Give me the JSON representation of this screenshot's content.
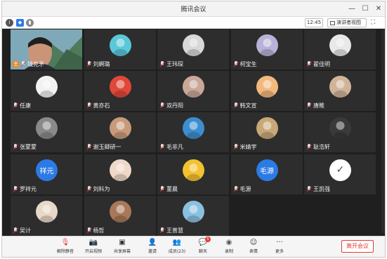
{
  "window": {
    "title": "腾讯会议"
  },
  "subbar": {
    "time": "12:45",
    "view_label": "演讲者视图"
  },
  "participants": [
    {
      "name": "钱克矛",
      "type": "video",
      "host": true,
      "host_badge": "主"
    },
    {
      "name": "刘婀璐",
      "type": "avatar",
      "avatar_color": "#5ac8d8"
    },
    {
      "name": "王玮琛",
      "type": "avatar",
      "avatar_color": "#d8d8d8"
    },
    {
      "name": "柯宝生",
      "type": "avatar",
      "avatar_color": "#b9b2d8"
    },
    {
      "name": "翟佳明",
      "type": "avatar",
      "avatar_color": "#e8e8e8"
    },
    {
      "name": "任康",
      "type": "avatar",
      "avatar_color": "#f2f2f2"
    },
    {
      "name": "黄亦石",
      "type": "avatar",
      "avatar_color": "#e0483a"
    },
    {
      "name": "双丹阳",
      "type": "avatar",
      "avatar_color": "#c9a89a"
    },
    {
      "name": "韩文宣",
      "type": "avatar",
      "avatar_color": "#f3b87e"
    },
    {
      "name": "唐睢",
      "type": "avatar",
      "avatar_color": "#d0b49a"
    },
    {
      "name": "张蒙蒙",
      "type": "avatar",
      "avatar_color": "#8a8a8a"
    },
    {
      "name": "谢玉卿研一",
      "type": "avatar",
      "avatar_color": "#c89a7a"
    },
    {
      "name": "毛非凡",
      "type": "avatar",
      "avatar_color": "#3c8ed0"
    },
    {
      "name": "米婧宇",
      "type": "avatar",
      "avatar_color": "#c8a878"
    },
    {
      "name": "耿浩轩",
      "type": "avatar",
      "avatar_color": "#3a3a3a"
    },
    {
      "name": "罗祥元",
      "type": "text",
      "avatar_text": "祥元"
    },
    {
      "name": "刘科为",
      "type": "avatar",
      "avatar_color": "#f0d8c8"
    },
    {
      "name": "董晨",
      "type": "avatar",
      "avatar_color": "#f2c230"
    },
    {
      "name": "毛源",
      "type": "text",
      "avatar_text": "毛源"
    },
    {
      "name": "王凯强",
      "type": "check",
      "avatar_text": "✓"
    },
    {
      "name": "吴计",
      "type": "avatar",
      "avatar_color": "#e8d8c8"
    },
    {
      "name": "杨哲",
      "type": "avatar",
      "avatar_color": "#a87858"
    },
    {
      "name": "王普慧",
      "type": "avatar",
      "avatar_color": "#8ac0e0"
    }
  ],
  "toolbar": {
    "items": [
      {
        "label": "解除静音",
        "icon": "mic-off-icon",
        "glyph": "🎙"
      },
      {
        "label": "开启视频",
        "icon": "video-off-icon",
        "glyph": "📷"
      },
      {
        "label": "共享屏幕",
        "icon": "share-screen-icon",
        "glyph": "▣"
      },
      {
        "label": "邀请",
        "icon": "invite-icon",
        "glyph": "👤"
      },
      {
        "label": "成员(23)",
        "icon": "members-icon",
        "glyph": "👥"
      },
      {
        "label": "聊天",
        "icon": "chat-icon",
        "glyph": "💬",
        "badge": "5"
      },
      {
        "label": "录制",
        "icon": "record-icon",
        "glyph": "◉"
      },
      {
        "label": "表情",
        "icon": "emoji-icon",
        "glyph": "☺"
      },
      {
        "label": "更多",
        "icon": "more-icon",
        "glyph": "···"
      }
    ],
    "leave_label": "离开会议"
  },
  "colors": {
    "host_badge": "#f08a24",
    "leave": "#e83a3a",
    "text_avatar": "#2c7be5"
  }
}
